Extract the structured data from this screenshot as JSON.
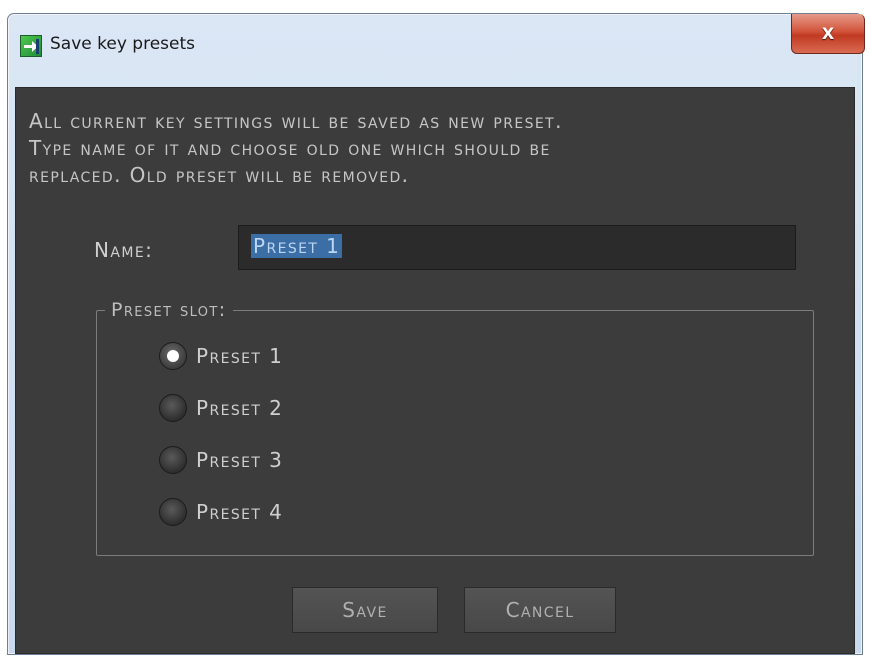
{
  "window": {
    "title": "Save key presets",
    "close_label": "X"
  },
  "message": {
    "lines": [
      "All current key settings will be saved as new preset.",
      "Type name of it and choose old one which should be",
      "replaced. Old preset will be removed."
    ]
  },
  "name_field": {
    "label": "Name:",
    "value": "Preset 1"
  },
  "preset_slot": {
    "label": "Preset slot:",
    "options": [
      {
        "label": "Preset 1",
        "checked": true
      },
      {
        "label": "Preset 2",
        "checked": false
      },
      {
        "label": "Preset 3",
        "checked": false
      },
      {
        "label": "Preset 4",
        "checked": false
      }
    ]
  },
  "buttons": {
    "save_label": "Save",
    "cancel_label": "Cancel"
  },
  "colors": {
    "panel_bg": "#3c3c3c",
    "text": "#c6c6c6",
    "selection": "#3a6ea5",
    "close_button": "#c03a21"
  }
}
